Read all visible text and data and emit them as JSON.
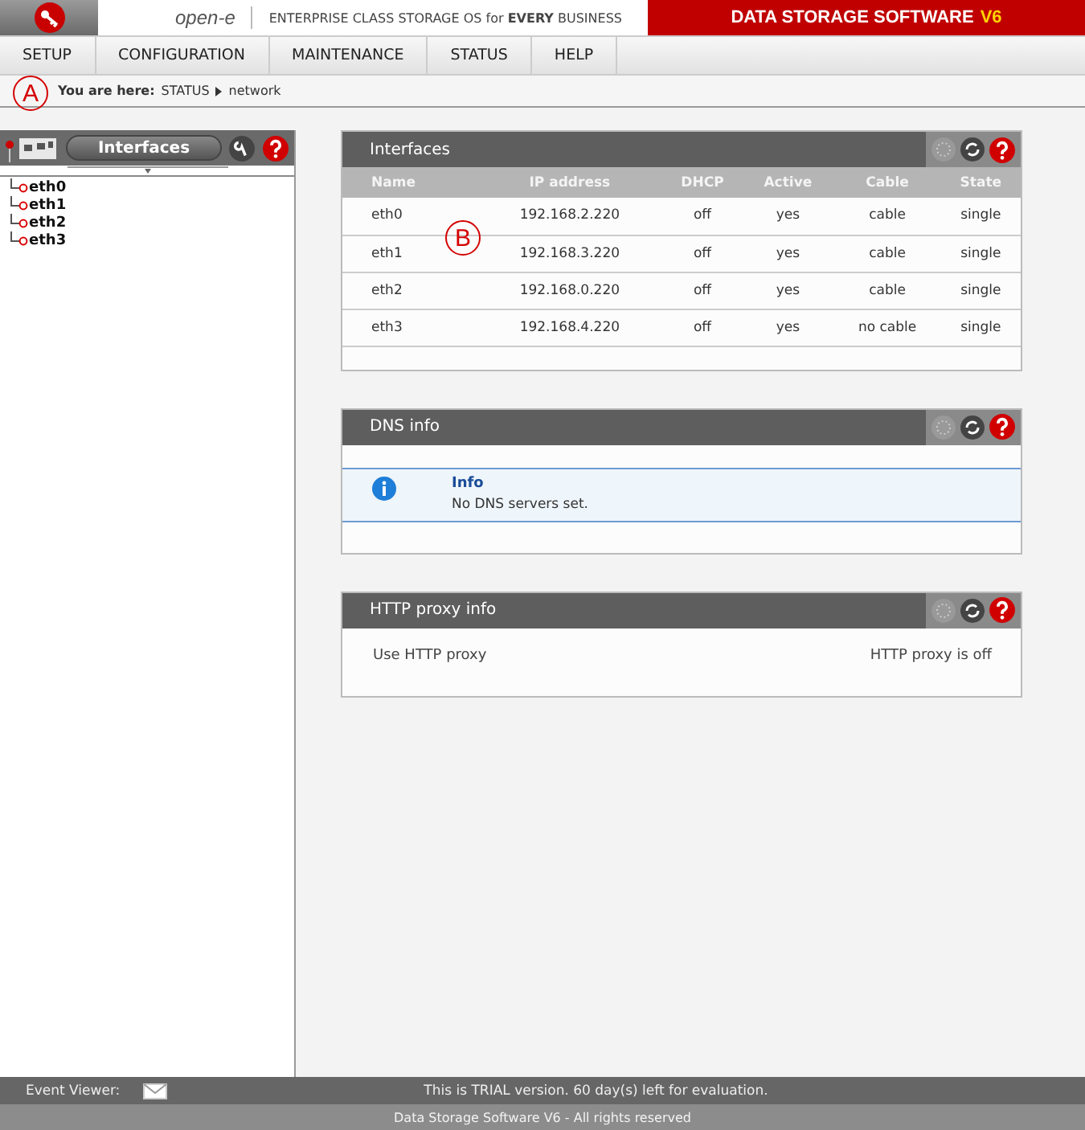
{
  "header": {
    "logo": "open-e",
    "tagline": "ENTERPRISE CLASS STORAGE OS for **EVERY** BUSINESS",
    "product": "DATA STORAGE SOFTWARE",
    "version": "V6"
  },
  "menu": [
    {
      "label": "SETUP",
      "selected": false
    },
    {
      "label": "CONFIGURATION",
      "selected": false
    },
    {
      "label": "MAINTENANCE",
      "selected": false
    },
    {
      "label": "STATUS",
      "selected": false
    },
    {
      "label": "HELP",
      "selected": false
    }
  ],
  "breadcrumb": {
    "label": "You are here:",
    "path": [
      "STATUS",
      "network"
    ]
  },
  "sidebar": {
    "title": "Interfaces",
    "items": [
      {
        "label": "eth0"
      },
      {
        "label": "eth1"
      },
      {
        "label": "eth2"
      },
      {
        "label": "eth3"
      }
    ]
  },
  "panels": [
    {
      "kind": "table",
      "title": "Interfaces",
      "columns": [
        "Name",
        "IP address",
        "DHCP",
        "Active",
        "Cable",
        "State"
      ],
      "rows": [
        [
          "eth0",
          "192.168.2.220",
          "off",
          "yes",
          "cable",
          "single"
        ],
        [
          "eth1",
          "192.168.3.220",
          "off",
          "yes",
          "cable",
          "single"
        ],
        [
          "eth2",
          "192.168.0.220",
          "off",
          "yes",
          "cable",
          "single"
        ],
        [
          "eth3",
          "192.168.4.220",
          "off",
          "yes",
          "no cable",
          "single"
        ]
      ]
    },
    {
      "kind": "info",
      "title": "DNS info",
      "heading": "Info",
      "message": "No DNS servers set."
    },
    {
      "kind": "keyvalue",
      "title": "HTTP proxy info",
      "label": "Use HTTP proxy",
      "value": "HTTP proxy is off"
    }
  ],
  "callouts": [
    {
      "label": "A"
    },
    {
      "label": "B"
    }
  ],
  "footer": {
    "event_label": "Event Viewer:",
    "trial": "This is TRIAL version. 60 day(s) left for evaluation.",
    "copyright": "Data Storage Software V6 - All rights reserved"
  }
}
